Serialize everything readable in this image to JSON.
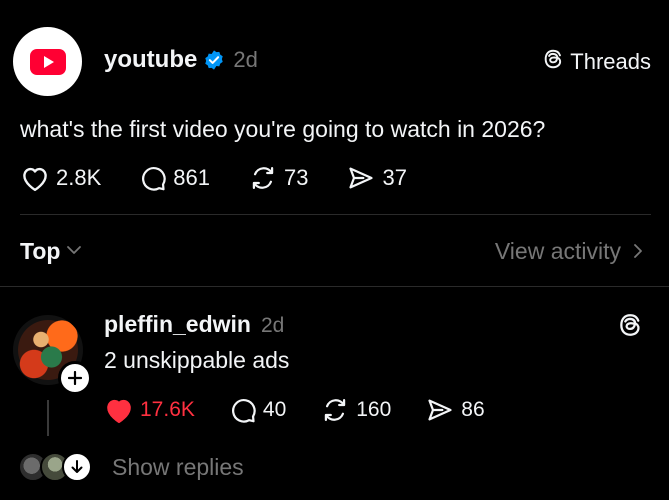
{
  "post": {
    "username": "youtube",
    "time": "2d",
    "brand_label": "Threads",
    "text": "what's the first video you're going to watch in 2026?",
    "stats": {
      "likes": "2.8K",
      "comments": "861",
      "reposts": "73",
      "shares": "37"
    }
  },
  "sort": {
    "label": "Top",
    "view_activity": "View activity"
  },
  "reply": {
    "username": "pleffin_edwin",
    "time": "2d",
    "text": "2 unskippable ads",
    "stats": {
      "likes": "17.6K",
      "comments": "40",
      "reposts": "160",
      "shares": "86"
    },
    "liked": true,
    "show_replies": "Show replies"
  },
  "colors": {
    "background": "#000000",
    "text": "#f3f5f7",
    "muted": "#777777",
    "like_active": "#ff3040",
    "verified": "#0095f6",
    "youtube_red": "#ff0033"
  },
  "icons": [
    "youtube-logo-icon",
    "verified-badge-icon",
    "threads-logo-icon",
    "heart-icon",
    "comment-icon",
    "repost-icon",
    "share-icon",
    "chevron-down-icon",
    "chevron-right-icon",
    "plus-icon",
    "arrow-down-icon"
  ]
}
